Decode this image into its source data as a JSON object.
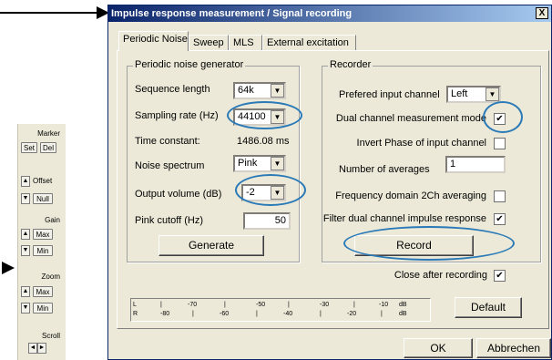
{
  "side_panel": {
    "marker_label": "Marker",
    "set_label": "Set",
    "del_label": "Del",
    "offset_label": "Offset",
    "null_label": "Null",
    "gain_label": "Gain",
    "gain_max_label": "Max",
    "gain_min_label": "Min",
    "zoom_label": "Zoom",
    "zoom_max_label": "Max",
    "zoom_min_label": "Min",
    "scroll_label": "Scroll"
  },
  "dialog": {
    "title": "Impulse response measurement / Signal recording",
    "close_label": "X",
    "tabs": [
      {
        "label": "Periodic Noise",
        "active": true
      },
      {
        "label": "Sweep",
        "active": false
      },
      {
        "label": "MLS",
        "active": false
      },
      {
        "label": "External excitation",
        "active": false
      }
    ],
    "generator": {
      "title": "Periodic noise generator",
      "sequence_length_label": "Sequence length",
      "sequence_length_value": "64k",
      "sampling_rate_label": "Sampling rate (Hz)",
      "sampling_rate_value": "44100",
      "time_constant_label": "Time constant:",
      "time_constant_value": "1486.08 ms",
      "noise_spectrum_label": "Noise spectrum",
      "noise_spectrum_value": "Pink",
      "output_volume_label": "Output volume (dB)",
      "output_volume_value": "-2",
      "pink_cutoff_label": "Pink cutoff (Hz)",
      "pink_cutoff_value": "50",
      "generate_label": "Generate"
    },
    "recorder": {
      "title": "Recorder",
      "input_channel_label": "Prefered input channel",
      "input_channel_value": "Left",
      "dual_channel_label": "Dual channel measurement mode",
      "dual_channel_checked": true,
      "invert_phase_label": "Invert Phase of input channel",
      "invert_phase_checked": false,
      "averages_label": "Number of averages",
      "averages_value": "1",
      "freq_averaging_label": "Frequency domain 2Ch averaging",
      "freq_averaging_checked": false,
      "filter_label": "Filter dual channel impulse response",
      "filter_checked": true,
      "record_label": "Record"
    },
    "close_after_label": "Close after recording",
    "close_after_checked": true,
    "meter": {
      "row_l": [
        "L",
        "|",
        "-70",
        "|",
        "-50",
        "|",
        "-30",
        "|",
        "-10",
        "dB"
      ],
      "row_r": [
        "R",
        "-80",
        "|",
        "-60",
        "|",
        "-40",
        "|",
        "-20",
        "|",
        "dB"
      ]
    },
    "default_label": "Default",
    "ok_label": "OK",
    "cancel_label": "Abbrechen"
  },
  "check_mark": "✔",
  "annotation_color": "#2a7ab8"
}
